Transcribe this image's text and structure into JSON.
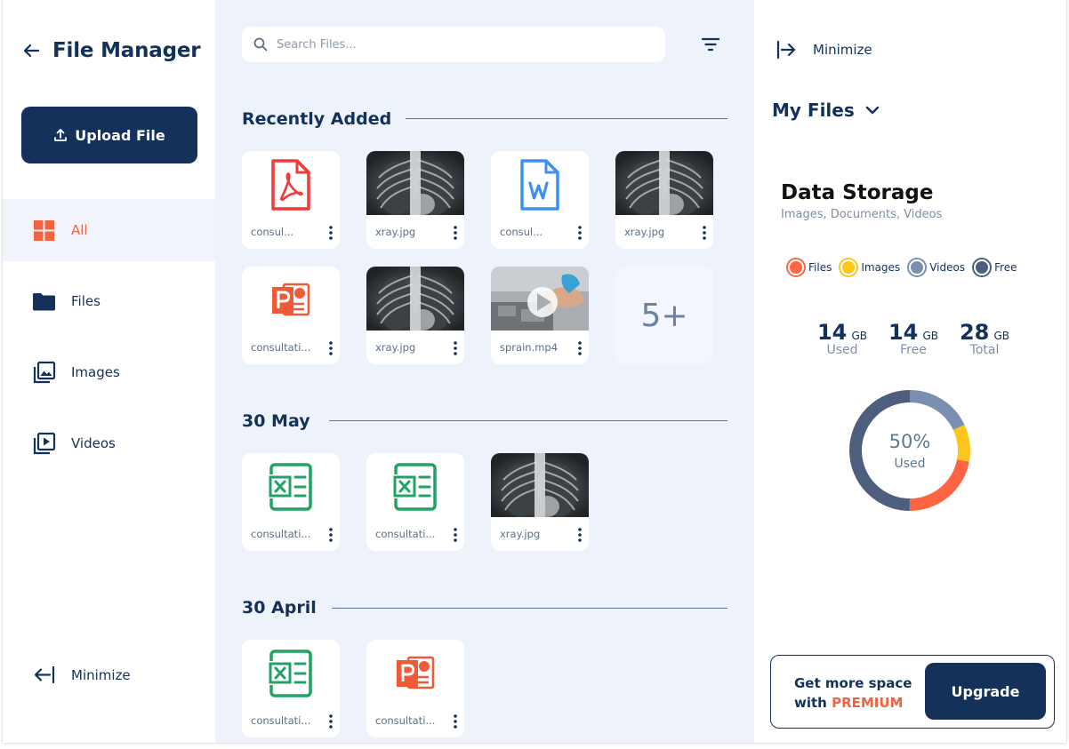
{
  "sidebar": {
    "title": "File Manager",
    "upload_label": "Upload File",
    "nav": [
      {
        "label": "All",
        "icon": "grid-icon",
        "active": true
      },
      {
        "label": "Files",
        "icon": "folder-icon"
      },
      {
        "label": "Images",
        "icon": "images-icon"
      },
      {
        "label": "Videos",
        "icon": "video-icon"
      }
    ],
    "minimize_label": "Minimize"
  },
  "search": {
    "placeholder": "Search Files..."
  },
  "sections": [
    {
      "title": "Recently Added",
      "files": [
        {
          "name": "consultation.pdf",
          "display": "consul...",
          "type": "pdf"
        },
        {
          "name": "xray.jpg",
          "display": "xray.jpg",
          "type": "image"
        },
        {
          "name": "consultation.docx",
          "display": "consul...",
          "type": "word"
        },
        {
          "name": "xray.jpg",
          "display": "xray.jpg",
          "type": "image"
        },
        {
          "name": "consultation.pptx",
          "display": "consultati...",
          "type": "powerpoint"
        },
        {
          "name": "xray.jpg",
          "display": "xray.jpg",
          "type": "image"
        },
        {
          "name": "sprain.mp4",
          "display": "sprain.mp4",
          "type": "video"
        }
      ],
      "more_label": "5+"
    },
    {
      "title": "30 May",
      "files": [
        {
          "name": "consultation.xlsx",
          "display": "consultati...",
          "type": "excel"
        },
        {
          "name": "consultation.xlsx",
          "display": "consultati...",
          "type": "excel"
        },
        {
          "name": "xray.jpg",
          "display": "xray.jpg",
          "type": "image"
        }
      ]
    },
    {
      "title": "30 April",
      "files": [
        {
          "name": "consultation.xlsx",
          "display": "consultati...",
          "type": "excel"
        },
        {
          "name": "consultation.pptx",
          "display": "consultati...",
          "type": "powerpoint"
        }
      ]
    }
  ],
  "right_panel": {
    "minimize_label": "Minimize",
    "my_files_label": "My Files",
    "storage_title": "Data Storage",
    "storage_subtitle": "Images, Documents, Videos",
    "legend": [
      {
        "label": "Files",
        "color": "#ff6543"
      },
      {
        "label": "Images",
        "color": "#fdc61a"
      },
      {
        "label": "Videos",
        "color": "#7b8fb0"
      },
      {
        "label": "Free",
        "color": "#4d5f7c"
      }
    ],
    "stats": [
      {
        "value": "14",
        "unit": "GB",
        "label": "Used"
      },
      {
        "value": "14",
        "unit": "GB",
        "label": "Free"
      },
      {
        "value": "28",
        "unit": "GB",
        "label": "Total"
      }
    ],
    "usage": {
      "percent_label": "50%",
      "label": "Used",
      "segments": [
        {
          "name": "Files",
          "fraction": 0.22,
          "color": "#ff6543"
        },
        {
          "name": "Images",
          "fraction": 0.1,
          "color": "#fdc61a"
        },
        {
          "name": "Videos",
          "fraction": 0.18,
          "color": "#7b8fb0"
        },
        {
          "name": "Free",
          "fraction": 0.5,
          "color": "#4d5f7c"
        }
      ]
    },
    "promo": {
      "line1": "Get more space",
      "line2_prefix": "with ",
      "line2_highlight": "PREMIUM",
      "button_label": "Upgrade"
    }
  },
  "colors": {
    "primary": "#14315a",
    "accent": "#f2633f",
    "center_bg": "#eef2fb"
  }
}
